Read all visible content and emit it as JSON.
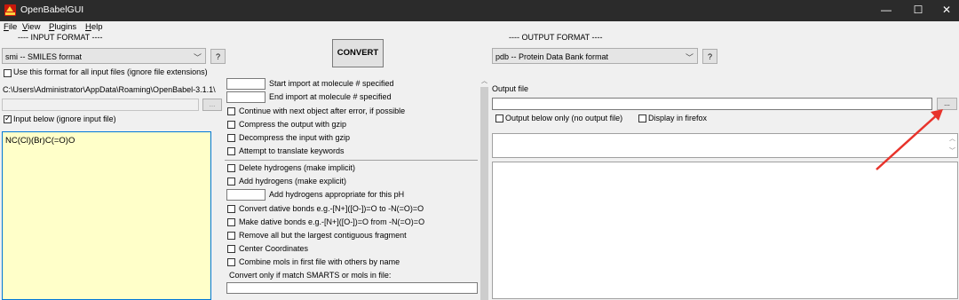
{
  "window": {
    "title": "OpenBabelGUI",
    "minimize": "—",
    "maximize": "☐",
    "close": "✕"
  },
  "menu": {
    "file": "File",
    "view": "View",
    "plugins": "Plugins",
    "help": "Help"
  },
  "input_format": {
    "header": "---- INPUT FORMAT ----",
    "selected": "smi -- SMILES format",
    "help_button": "?",
    "use_for_all": "Use this format for all input files (ignore file extensions)",
    "path": "C:\\Users\\Administrator\\AppData\\Roaming\\OpenBabel-3.1.1\\",
    "browse": "...",
    "input_below": "Input below (ignore input file)",
    "input_below_checked": true,
    "text": "NC(Cl)(Br)C(=O)O"
  },
  "convert_button": "CONVERT",
  "options": {
    "start_import": "Start import at molecule # specified",
    "end_import": "End import at molecule # specified",
    "continue_error": "Continue with next object after error, if possible",
    "compress_gzip": "Compress the output with gzip",
    "decompress_gzip": "Decompress the input with gzip",
    "translate_keywords": "Attempt to translate keywords",
    "delete_h": "Delete hydrogens (make implicit)",
    "add_h": "Add hydrogens (make explicit)",
    "add_h_ph": "Add hydrogens appropriate for this pH",
    "dative_to": "Convert dative bonds e.g.-[N+]([O-])=O to -N(=O)=O",
    "dative_from": "Make dative bonds e.g.-[N+]([O-])=O from -N(=O)=O",
    "largest_fragment": "Remove all but the largest contiguous fragment",
    "center_coords": "Center Coordinates",
    "combine_mols": "Combine mols in first file with others by name",
    "smarts_label": "Convert only if match SMARTS or mols in file:"
  },
  "output_format": {
    "header": "---- OUTPUT FORMAT ----",
    "selected": "pdb -- Protein Data Bank format",
    "help_button": "?",
    "output_file_label": "Output file",
    "browse": "...",
    "output_below_only": "Output below only (no output file)",
    "display_firefox": "Display in firefox"
  },
  "annotation": {
    "arrow_color": "#e8332b"
  }
}
